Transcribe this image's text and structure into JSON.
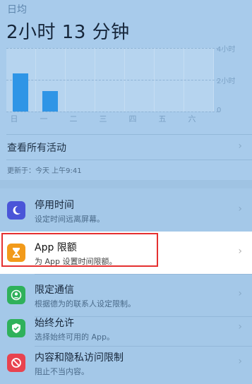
{
  "header": {
    "avg_label": "日均",
    "total_time": "2小时 13 分钟"
  },
  "chart_data": {
    "type": "bar",
    "categories": [
      "日",
      "一",
      "二",
      "三",
      "四",
      "五",
      "六"
    ],
    "values": [
      2.4,
      1.3,
      0,
      0,
      0,
      0,
      0
    ],
    "yticks": [
      "4小时",
      "2小时",
      "0"
    ],
    "ylim": [
      0,
      4
    ],
    "grid": true,
    "bar_color": "#2f95e6"
  },
  "links": {
    "see_all": "查看所有活动"
  },
  "updated": "更新于：今天 上午9:41",
  "settings": [
    {
      "key": "downtime",
      "title": "停用时间",
      "subtitle": "设定时间远离屏幕。",
      "icon": "moon-icon",
      "color": "#4a55d8"
    },
    {
      "key": "app-limits",
      "title": "App 限额",
      "subtitle": "为 App 设置时间限额。",
      "icon": "hourglass-icon",
      "color": "#f29a1a"
    },
    {
      "key": "communication-limits",
      "title": "限定通信",
      "subtitle": "根据德为的联系人设定限制。",
      "icon": "person-icon",
      "color": "#2fb15b"
    },
    {
      "key": "always-allowed",
      "title": "始终允许",
      "subtitle": "选择始终可用的 App。",
      "icon": "checkmark-shield-icon",
      "color": "#2fb15b"
    },
    {
      "key": "content-privacy",
      "title": "内容和隐私访问限制",
      "subtitle": "阻止不当内容。",
      "icon": "prohibit-icon",
      "color": "#e8434f"
    }
  ]
}
